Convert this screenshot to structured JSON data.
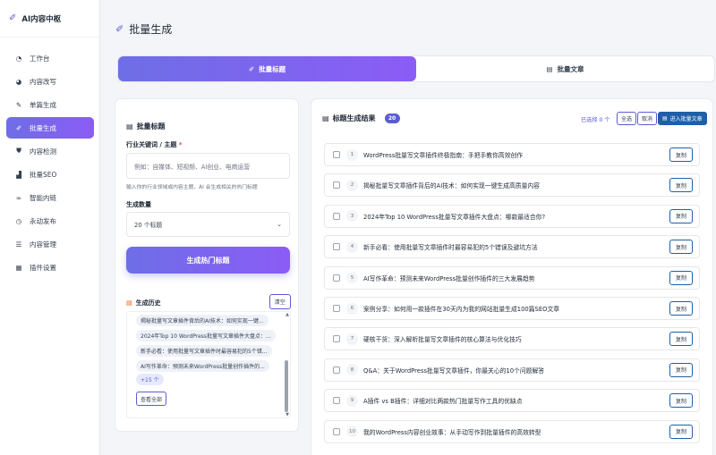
{
  "sidebar": {
    "brand": "AI内容中枢",
    "items": [
      {
        "label": "工作台",
        "icon": "dashboard-icon",
        "glyph": "◔"
      },
      {
        "label": "内容改写",
        "icon": "paint-icon",
        "glyph": "◕"
      },
      {
        "label": "单篇生成",
        "icon": "edit-icon",
        "glyph": "✎"
      },
      {
        "label": "批量生成",
        "icon": "pen-icon",
        "glyph": "✐"
      },
      {
        "label": "内容检测",
        "icon": "shield-icon",
        "glyph": "⛊"
      },
      {
        "label": "批量SEO",
        "icon": "chart-icon",
        "glyph": "▟"
      },
      {
        "label": "智能内链",
        "icon": "link-icon",
        "glyph": "∞"
      },
      {
        "label": "永动发布",
        "icon": "clock-icon",
        "glyph": "◷"
      },
      {
        "label": "内容管理",
        "icon": "list-icon",
        "glyph": "☰"
      },
      {
        "label": "插件设置",
        "icon": "plugin-icon",
        "glyph": "▦"
      }
    ],
    "active_index": 3
  },
  "page": {
    "title": "批量生成"
  },
  "tabs": [
    {
      "label": "批量标题",
      "icon": "pen-icon"
    },
    {
      "label": "批量文章",
      "icon": "file-icon"
    }
  ],
  "left_panel": {
    "title": "批量标题",
    "keyword_label": "行业关键词 / 主题",
    "keyword_required": "*",
    "keyword_placeholder": "例如：自媒体、短视频、AI创业、电商运营",
    "keyword_hint": "输入你的行业领域或内容主题，AI 会生成相关的热门标题",
    "count_label": "生成数量",
    "count_value": "20 个标题",
    "generate_button": "生成热门标题",
    "history_title": "生成历史",
    "clear_button": "清空",
    "history": [
      "揭秘批量写文章插件背后的AI技术：如何实现一键...",
      "2024年Top 10 WordPress批量写文章插件大盘点：...",
      "新手必看：使用批量写文章插件时最容易犯的5个错...",
      "AI写作革命：预测未来WordPress批量创作插件的..."
    ],
    "more_label": "+15 个",
    "view_all_button": "查看全部"
  },
  "results": {
    "title": "标题生成结果",
    "count": "20",
    "selected_text": "已选择 0 个",
    "select_all": "全选",
    "cancel": "取消",
    "enter_batch": "进入批量文章",
    "copy_label": "复制",
    "items": [
      "WordPress批量写文章插件终极指南：手把手教你高效创作",
      "揭秘批量写文章插件背后的AI技术：如何实现一键生成高质量内容",
      "2024年Top 10 WordPress批量写文章插件大盘点：哪款最适合你?",
      "新手必看：使用批量写文章插件时最容易犯的5个错误及避坑方法",
      "AI写作革命：预测未来WordPress批量创作插件的三大发展趋势",
      "案例分享：如何用一款插件在30天内为我的网站批量生成100篇SEO文章",
      "硬核干货：深入解析批量写文章插件的核心算法与优化技巧",
      "Q&A：关于WordPress批量写文章插件，你最关心的10个问题解答",
      "A插件 vs B插件：详细对比两款热门批量写作工具的优缺点",
      "我的WordPress内容创业故事：从手动写作到批量插件的高效转型"
    ]
  }
}
